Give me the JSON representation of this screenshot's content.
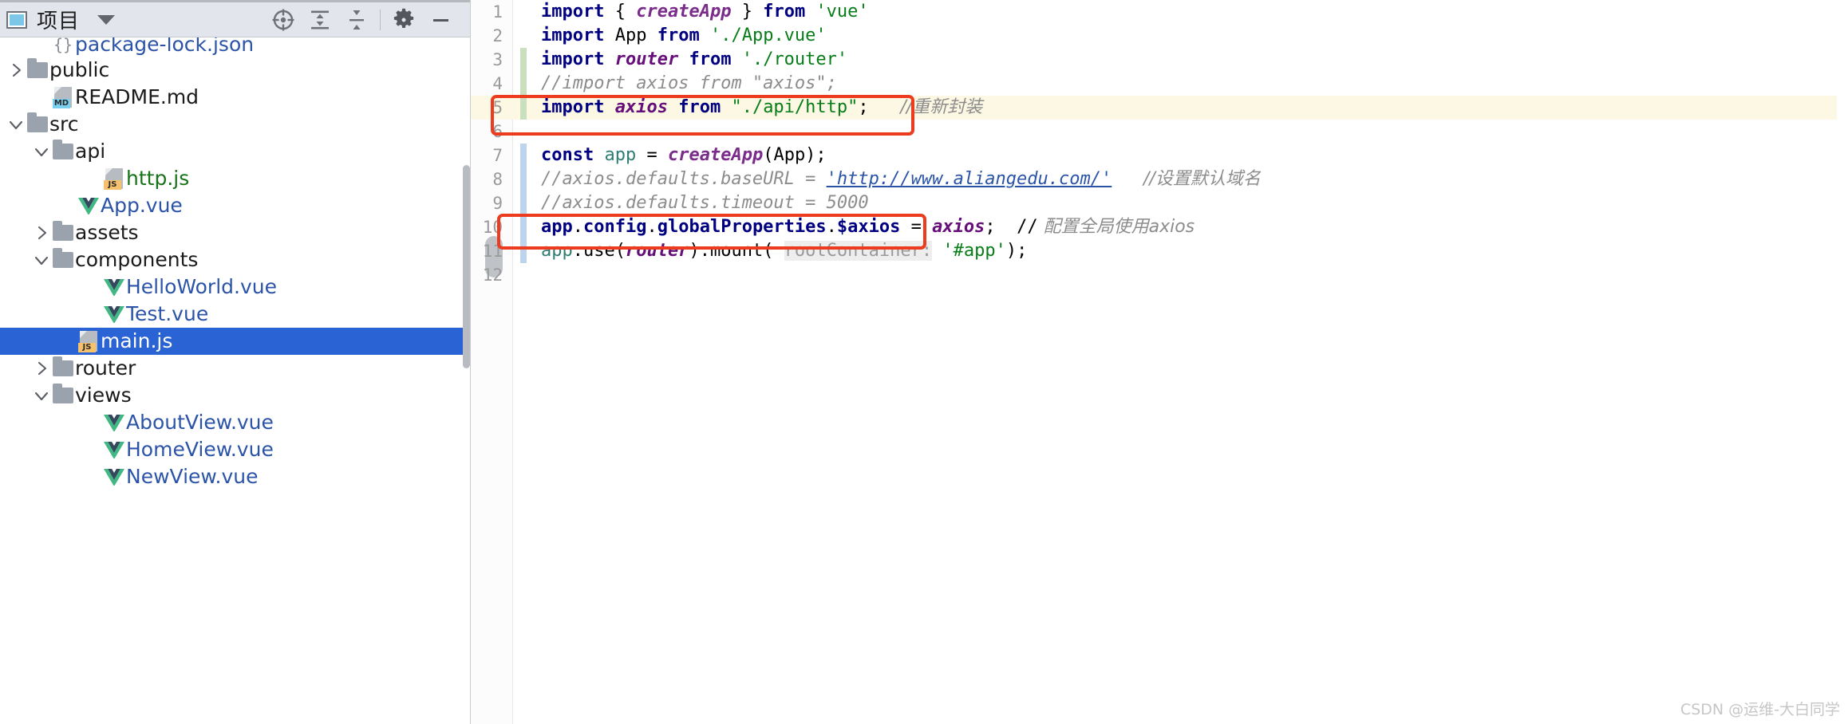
{
  "window": {
    "panel_title": "项目",
    "watermark": "CSDN @运维-大白同学"
  },
  "toolbar": {
    "items": [
      {
        "name": "locate-crosshair-icon",
        "label": "Select Opened File"
      },
      {
        "name": "expand-all-icon",
        "label": "Expand All"
      },
      {
        "name": "collapse-all-icon",
        "label": "Collapse All"
      },
      {
        "name": "gear-icon",
        "label": "Settings"
      },
      {
        "name": "minimize-icon",
        "label": "Hide"
      }
    ]
  },
  "tree": {
    "items": [
      {
        "label": "package-lock.json",
        "icon": "json-file-icon",
        "indent": 1,
        "arrow": "none",
        "color": "blue",
        "selected": false,
        "clipped_top": true
      },
      {
        "label": "public",
        "icon": "folder-icon",
        "indent": 0,
        "arrow": "right",
        "color": "plain",
        "selected": false
      },
      {
        "label": "README.md",
        "icon": "md-file-icon",
        "indent": 1,
        "arrow": "none",
        "color": "plain",
        "selected": false
      },
      {
        "label": "src",
        "icon": "folder-icon",
        "indent": 0,
        "arrow": "down",
        "color": "plain",
        "selected": false
      },
      {
        "label": "api",
        "icon": "folder-icon",
        "indent": 1,
        "arrow": "down",
        "color": "plain",
        "selected": false
      },
      {
        "label": "http.js",
        "icon": "js-file-icon",
        "indent": 3,
        "arrow": "none",
        "color": "green",
        "selected": false
      },
      {
        "label": "App.vue",
        "icon": "vue-file-icon",
        "indent": 2,
        "arrow": "none",
        "color": "blue",
        "selected": false
      },
      {
        "label": "assets",
        "icon": "folder-icon",
        "indent": 1,
        "arrow": "right",
        "color": "plain",
        "selected": false
      },
      {
        "label": "components",
        "icon": "folder-icon",
        "indent": 1,
        "arrow": "down",
        "color": "plain",
        "selected": false
      },
      {
        "label": "HelloWorld.vue",
        "icon": "vue-file-icon",
        "indent": 3,
        "arrow": "none",
        "color": "blue",
        "selected": false
      },
      {
        "label": "Test.vue",
        "icon": "vue-file-icon",
        "indent": 3,
        "arrow": "none",
        "color": "blue",
        "selected": false
      },
      {
        "label": "main.js",
        "icon": "js-file-icon",
        "indent": 2,
        "arrow": "none",
        "color": "plain",
        "selected": true
      },
      {
        "label": "router",
        "icon": "folder-icon",
        "indent": 1,
        "arrow": "right",
        "color": "plain",
        "selected": false
      },
      {
        "label": "views",
        "icon": "folder-icon",
        "indent": 1,
        "arrow": "down",
        "color": "plain",
        "selected": false
      },
      {
        "label": "AboutView.vue",
        "icon": "vue-file-icon",
        "indent": 3,
        "arrow": "none",
        "color": "blue",
        "selected": false
      },
      {
        "label": "HomeView.vue",
        "icon": "vue-file-icon",
        "indent": 3,
        "arrow": "none",
        "color": "blue",
        "selected": false
      },
      {
        "label": "NewView.vue",
        "icon": "vue-file-icon",
        "indent": 3,
        "arrow": "none",
        "color": "blue",
        "selected": false
      }
    ]
  },
  "editor": {
    "lines": [
      {
        "n": "1",
        "change": "none",
        "highlight": false
      },
      {
        "n": "2",
        "change": "none",
        "highlight": false
      },
      {
        "n": "3",
        "change": "green",
        "highlight": false
      },
      {
        "n": "4",
        "change": "green",
        "highlight": false
      },
      {
        "n": "5",
        "change": "green",
        "highlight": true
      },
      {
        "n": "6",
        "change": "none",
        "highlight": false
      },
      {
        "n": "7",
        "change": "blue",
        "highlight": false
      },
      {
        "n": "8",
        "change": "blue",
        "highlight": false
      },
      {
        "n": "9",
        "change": "blue",
        "highlight": false
      },
      {
        "n": "10",
        "change": "blue",
        "highlight": false
      },
      {
        "n": "11",
        "change": "blue",
        "highlight": false
      },
      {
        "n": "12",
        "change": "none",
        "highlight": false
      }
    ],
    "code": {
      "l1": "import { createApp } from 'vue'",
      "l2": "import App from './App.vue'",
      "l3": "import router from './router'",
      "l4": "//import axios from \"axios\";",
      "l5": "import axios from \"./api/http\";   //重新封装",
      "l6": "",
      "l7": "const app = createApp(App);",
      "l8": "//axios.defaults.baseURL = 'http://www.aliangedu.com/'   //设置默认域名",
      "l9": "//axios.defaults.timeout = 5000",
      "l10": "app.config.globalProperties.$axios = axios;  // 配置全局使用axios",
      "l11": "app.use(router).mount( rootContainer: '#app');",
      "l12": ""
    },
    "tokens": {
      "import": "import",
      "from": "from",
      "const": "const",
      "createApp": "createApp",
      "vue_str": "'vue'",
      "app_vue_str": "'./App.vue'",
      "router_str": "'./router'",
      "http_str": "\"./api/http\"",
      "app_str": "'#app'",
      "router_id": "router",
      "axios_id": "axios",
      "app_id": "app",
      "App_id": "App",
      "use_chain": ".use(",
      "mount_chain": ").mount(",
      "param_hint": "rootContainer:",
      "comment4": "//import axios from \"axios\";",
      "comment5_zh": "//重新封装",
      "comment8_a": "//axios.defaults.baseURL = ",
      "comment8_url": "'http://www.aliangedu.com/'",
      "comment8_zh": "//设置默认域名",
      "comment9": "//axios.defaults.timeout = 5000",
      "line10_prop": "app.config.globalProperties.$axios",
      "line10_eq": " = ",
      "line10_axios": "axios",
      "line10_semi": ";  //",
      "line10_zh": " 配置全局使用axios"
    },
    "annotations": [
      {
        "name": "annotation-box-line5",
        "note": "red rectangle around line 5 import axios"
      },
      {
        "name": "annotation-box-line10",
        "note": "red rectangle around line 10 globalProperties"
      }
    ]
  },
  "colors": {
    "selection": "#2a63d4",
    "annotation": "#ec3b1e",
    "highlight_line": "#fdf8e3",
    "change_green": "#c9dfbd",
    "change_blue": "#bdd4ec",
    "header_bg": "#e2e5ec"
  }
}
